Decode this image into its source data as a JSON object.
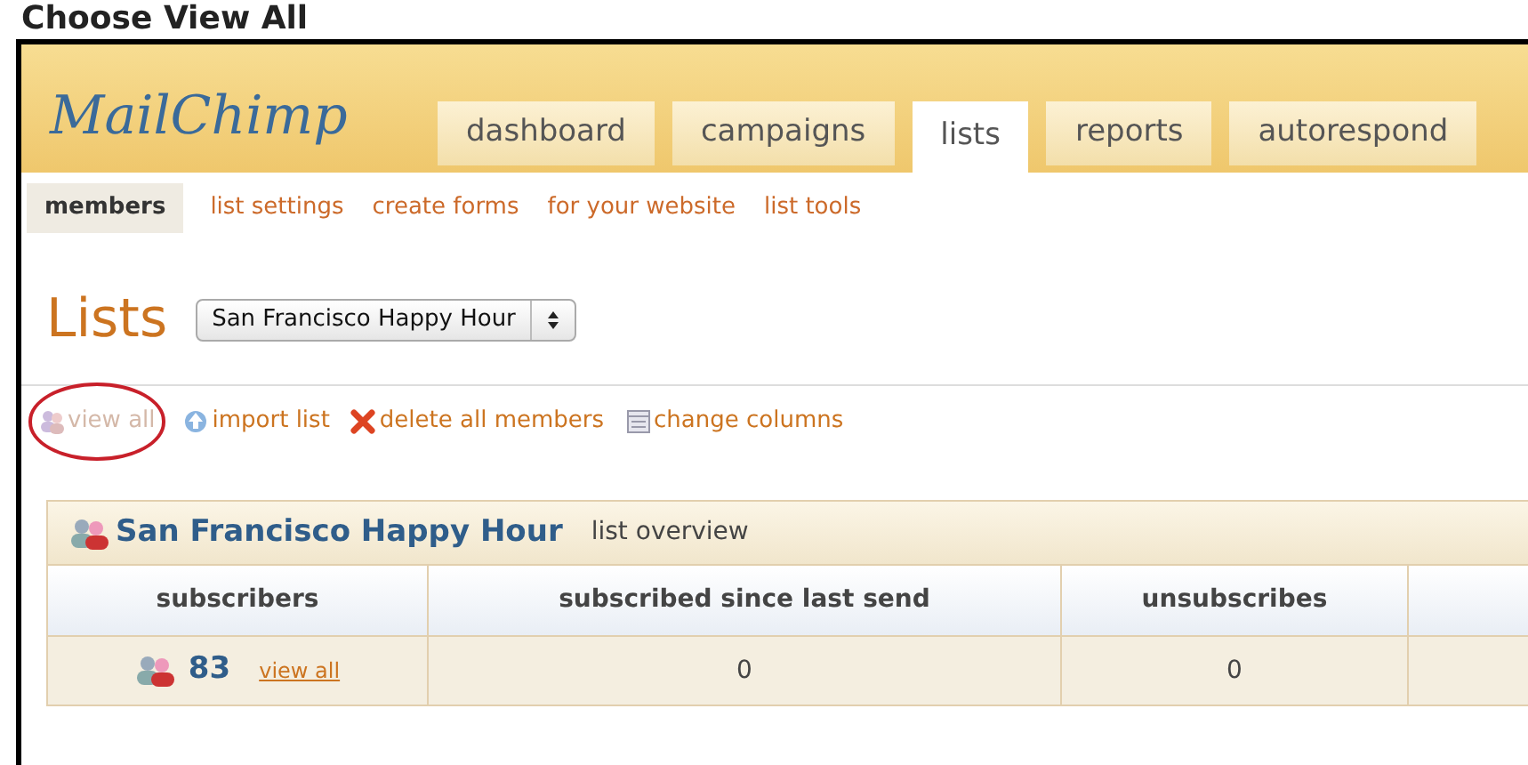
{
  "caption": "Choose View All",
  "logo": "MailChimp",
  "tabs": [
    {
      "label": "dashboard",
      "selected": false
    },
    {
      "label": "campaigns",
      "selected": false
    },
    {
      "label": "lists",
      "selected": true
    },
    {
      "label": "reports",
      "selected": false
    },
    {
      "label": "autorespond",
      "selected": false
    }
  ],
  "subnav": [
    {
      "label": "members",
      "selected": true
    },
    {
      "label": "list settings",
      "selected": false
    },
    {
      "label": "create forms",
      "selected": false
    },
    {
      "label": "for your website",
      "selected": false
    },
    {
      "label": "list tools",
      "selected": false
    }
  ],
  "page_title": "Lists",
  "list_select": {
    "value": "San Francisco Happy Hour"
  },
  "actions": [
    {
      "kind": "people",
      "label": "view all",
      "disabled": true,
      "circled": true
    },
    {
      "kind": "upload",
      "label": "import list",
      "disabled": false,
      "circled": false
    },
    {
      "kind": "delete",
      "label": "delete all members",
      "disabled": false,
      "circled": false
    },
    {
      "kind": "columns",
      "label": "change columns",
      "disabled": false,
      "circled": false
    }
  ],
  "overview": {
    "list_name": "San Francisco Happy Hour",
    "subtitle": "list overview",
    "columns": [
      "subscribers",
      "subscribed since last send",
      "unsubscribes"
    ],
    "row": {
      "subscribers": "83",
      "link": "view all",
      "since_last_send": "0",
      "unsubscribes": "0"
    }
  }
}
